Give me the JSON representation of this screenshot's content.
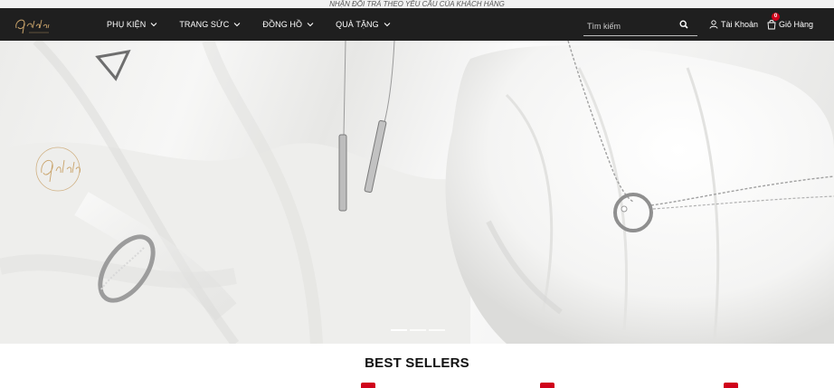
{
  "announcement": "NHẬN ĐỔI TRẢ THEO YÊU CẦU CỦA KHÁCH HÀNG",
  "nav": {
    "items": [
      {
        "label": "PHỤ KIỆN"
      },
      {
        "label": "TRANG SỨC"
      },
      {
        "label": "ĐỒNG HỒ"
      },
      {
        "label": "QUÀ TẶNG"
      }
    ]
  },
  "search": {
    "placeholder": "Tìm kiếm"
  },
  "account": {
    "label": "Tài Khoản"
  },
  "cart": {
    "label": "Giỏ Hàng",
    "count": "0"
  },
  "carousel": {
    "slides": 3,
    "active": 1
  },
  "section": {
    "title": "BEST SELLERS"
  },
  "colors": {
    "nav_bg": "#1f1f1f",
    "accent_red": "#d0021b",
    "gold": "#c9a36a"
  }
}
